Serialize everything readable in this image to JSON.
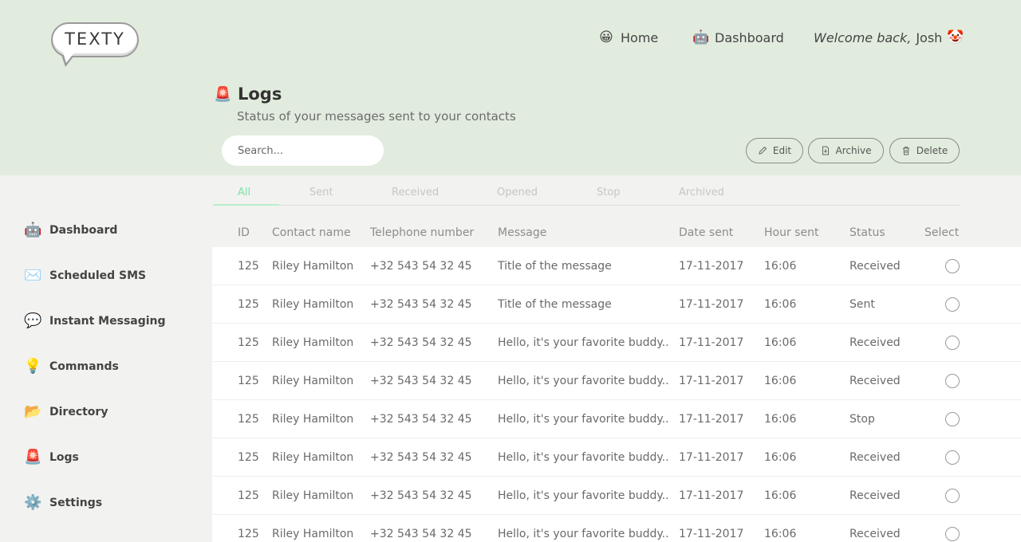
{
  "app": {
    "logo_text": "TEXTY"
  },
  "topnav": {
    "home": {
      "label": "Home",
      "emoji": "😀"
    },
    "dashboard": {
      "label": "Dashboard",
      "emoji": "🤖"
    },
    "welcome_text": "Welcome back,",
    "user_name": "Josh",
    "user_emoji": "🤡"
  },
  "page": {
    "title": "Logs",
    "title_emoji": "🚨",
    "subtitle": "Status of your messages sent to your contacts"
  },
  "search": {
    "placeholder": "Search..."
  },
  "actions": {
    "edit": "Edit",
    "archive": "Archive",
    "delete": "Delete"
  },
  "tabs": [
    {
      "label": "All",
      "active": true
    },
    {
      "label": "Sent"
    },
    {
      "label": "Received"
    },
    {
      "label": "Opened"
    },
    {
      "label": "Stop"
    },
    {
      "label": "Archived"
    }
  ],
  "sidebar": {
    "items": [
      {
        "label": "Dashboard",
        "emoji": "🤖"
      },
      {
        "label": "Scheduled SMS",
        "emoji": "✉️"
      },
      {
        "label": "Instant Messaging",
        "emoji": "💬"
      },
      {
        "label": "Commands",
        "emoji": "💡"
      },
      {
        "label": "Directory",
        "emoji": "📂"
      },
      {
        "label": "Logs",
        "emoji": "🚨"
      },
      {
        "label": "Settings",
        "emoji": "⚙️"
      }
    ]
  },
  "table": {
    "columns": [
      "ID",
      "Contact name",
      "Telephone number",
      "Message",
      "Date sent",
      "Hour sent",
      "Status",
      "Select"
    ],
    "rows": [
      {
        "id": "125",
        "contact": "Riley Hamilton",
        "phone": "+32 543 54 32 45",
        "message": "Title of the message",
        "date": "17-11-2017",
        "hour": "16:06",
        "status": "Received"
      },
      {
        "id": "125",
        "contact": "Riley Hamilton",
        "phone": "+32 543 54 32 45",
        "message": "Title of the message",
        "date": "17-11-2017",
        "hour": "16:06",
        "status": "Sent"
      },
      {
        "id": "125",
        "contact": "Riley Hamilton",
        "phone": "+32 543 54 32 45",
        "message": "Hello, it's your favorite buddy..",
        "date": "17-11-2017",
        "hour": "16:06",
        "status": "Received"
      },
      {
        "id": "125",
        "contact": "Riley Hamilton",
        "phone": "+32 543 54 32 45",
        "message": "Hello, it's your favorite buddy..",
        "date": "17-11-2017",
        "hour": "16:06",
        "status": "Received"
      },
      {
        "id": "125",
        "contact": "Riley Hamilton",
        "phone": "+32 543 54 32 45",
        "message": "Hello, it's your favorite buddy..",
        "date": "17-11-2017",
        "hour": "16:06",
        "status": "Stop"
      },
      {
        "id": "125",
        "contact": "Riley Hamilton",
        "phone": "+32 543 54 32 45",
        "message": "Hello, it's your favorite buddy..",
        "date": "17-11-2017",
        "hour": "16:06",
        "status": "Received"
      },
      {
        "id": "125",
        "contact": "Riley Hamilton",
        "phone": "+32 543 54 32 45",
        "message": "Hello, it's your favorite buddy..",
        "date": "17-11-2017",
        "hour": "16:06",
        "status": "Received"
      },
      {
        "id": "125",
        "contact": "Riley Hamilton",
        "phone": "+32 543 54 32 45",
        "message": "Hello, it's your favorite buddy..",
        "date": "17-11-2017",
        "hour": "16:06",
        "status": "Received"
      }
    ]
  },
  "colors": {
    "header_bg": "#e2ecde",
    "active_tab": "#7ee0a8",
    "page_bg": "#f2f2f0"
  }
}
